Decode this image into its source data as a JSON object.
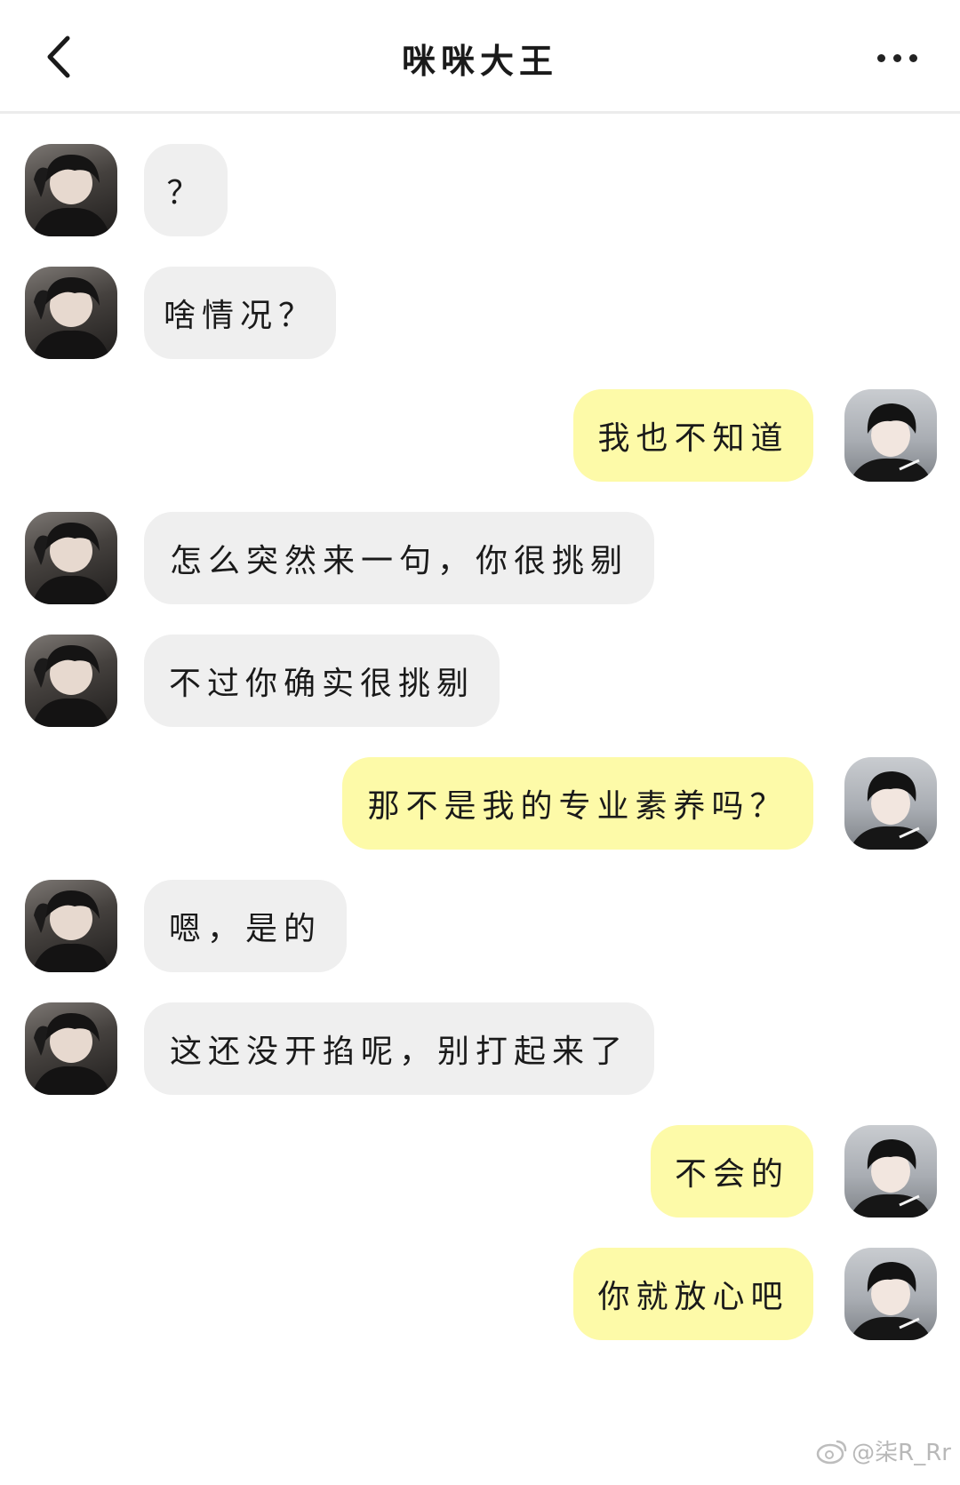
{
  "header": {
    "title": "咪咪大王"
  },
  "messages": [
    {
      "side": "left",
      "text": "？"
    },
    {
      "side": "left",
      "text": "啥情况？"
    },
    {
      "side": "right",
      "text": "我也不知道"
    },
    {
      "side": "left",
      "text": "怎么突然来一句，你很挑剔"
    },
    {
      "side": "left",
      "text": "不过你确实很挑剔"
    },
    {
      "side": "right",
      "text": "那不是我的专业素养吗？"
    },
    {
      "side": "left",
      "text": "嗯，是的"
    },
    {
      "side": "left",
      "text": "这还没开掐呢，别打起来了"
    },
    {
      "side": "right",
      "text": "不会的"
    },
    {
      "side": "right",
      "text": "你就放心吧"
    }
  ],
  "watermark": {
    "text": "@柒R_Rr"
  },
  "colors": {
    "incoming_bubble": "#efefef",
    "outgoing_bubble": "#fdfaa8"
  }
}
